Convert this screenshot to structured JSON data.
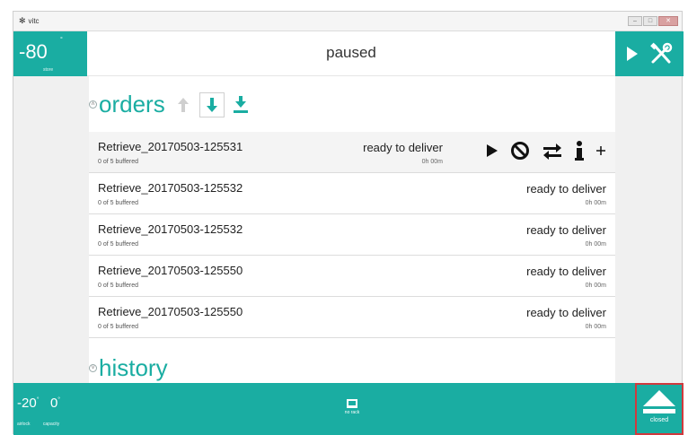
{
  "window": {
    "app_title": "vitc",
    "app_icon": "snowflake-icon"
  },
  "top_left": {
    "temperature": "-80",
    "unit": "°",
    "sub_label": "store"
  },
  "status": {
    "text": "paused"
  },
  "top_right": {
    "icons": [
      "play-icon",
      "tools-icon"
    ]
  },
  "orders": {
    "title": "orders",
    "header_icons": [
      "arrow-up-icon",
      "arrow-down-icon",
      "download-icon"
    ],
    "rows": [
      {
        "name": "Retrieve_20170503-125531",
        "buffered": "0 of 5 buffered",
        "status": "ready to deliver",
        "time": "0h 00m"
      },
      {
        "name": "Retrieve_20170503-125532",
        "buffered": "0 of 5 buffered",
        "status": "ready to deliver",
        "time": "0h 00m"
      },
      {
        "name": "Retrieve_20170503-125532",
        "buffered": "0 of 5 buffered",
        "status": "ready to deliver",
        "time": "0h 00m"
      },
      {
        "name": "Retrieve_20170503-125550",
        "buffered": "0 of 5 buffered",
        "status": "ready to deliver",
        "time": "0h 00m"
      },
      {
        "name": "Retrieve_20170503-125550",
        "buffered": "0 of 5 buffered",
        "status": "ready to deliver",
        "time": "0h 00m"
      }
    ],
    "row_action_icons": [
      "play-icon",
      "cancel-icon",
      "swap-icon",
      "info-icon",
      "plus-icon"
    ]
  },
  "history": {
    "title": "history"
  },
  "bottom": {
    "temp1": "-20",
    "temp1_unit": "°",
    "temp1_label": "airlock",
    "temp2": "0",
    "temp2_unit": "°",
    "temp2_label": "capacity",
    "center_label": "no rack",
    "eject_label": "closed"
  },
  "colors": {
    "accent": "#1aada2",
    "highlight_border": "#d0393d"
  }
}
